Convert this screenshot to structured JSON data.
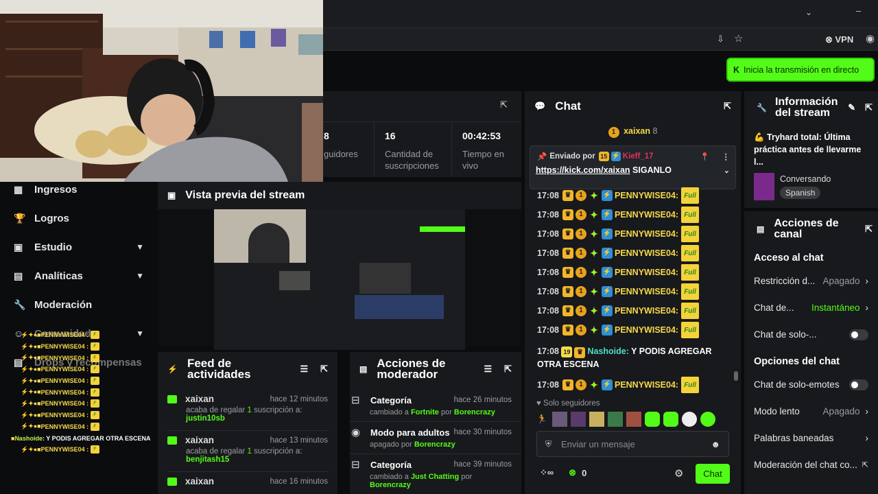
{
  "browser": {
    "vpn_label": "VPN"
  },
  "header": {
    "start_stream_label": "Inicia la transmisión en directo"
  },
  "stats": [
    {
      "value": "8",
      "label": "guidores"
    },
    {
      "value": "16",
      "label": "Cantidad de suscripciones"
    },
    {
      "value": "00:42:53",
      "label": "Tiempo en vivo"
    }
  ],
  "sidebar": {
    "items": [
      {
        "label": "Ingresos"
      },
      {
        "label": "Logros"
      },
      {
        "label": "Estudio"
      },
      {
        "label": "Analíticas"
      },
      {
        "label": "Moderación"
      },
      {
        "label": "Comunidad"
      },
      {
        "label": "Drops y recompensas"
      }
    ]
  },
  "preview": {
    "title": "Vista previa del stream"
  },
  "feed": {
    "title": "Feed de actividades",
    "items": [
      {
        "user": "xaixan",
        "time": "hace 12 minutos",
        "text": "acaba de regalar",
        "count": "1",
        "text2": "suscripción a:",
        "target": "justin10sb"
      },
      {
        "user": "xaixan",
        "time": "hace 13 minutos",
        "text": "acaba de regalar",
        "count": "1",
        "text2": "suscripción a:",
        "target": "benjitash15"
      },
      {
        "user": "xaixan",
        "time": "hace 16 minutos"
      }
    ]
  },
  "mod_actions": {
    "title": "Acciones de moderador",
    "items": [
      {
        "title": "Categoría",
        "time": "hace 26 minutos",
        "pre": "cambiado a",
        "value": "Fortnite",
        "by": "por",
        "mod": "Borencrazy"
      },
      {
        "title": "Modo para adultos",
        "time": "hace 30 minutos",
        "pre": "apagado por",
        "value": "",
        "by": "",
        "mod": "Borencrazy"
      },
      {
        "title": "Categoría",
        "time": "hace 39 minutos",
        "pre": "cambiado a",
        "value": "Just Chatting",
        "by": "por",
        "mod": "Borencrazy"
      }
    ]
  },
  "chat": {
    "title": "Chat",
    "top_user": "xaixan",
    "top_count": "8",
    "pinned_by_label": "Enviado por",
    "pinned_badge": "15",
    "pinned_user": "Kieff_17",
    "pinned_link": "https://kick.com/xaixan",
    "pinned_text": "SIGANLO",
    "repeat_user": "PENNYWISE04:",
    "emote_text": "Full",
    "time": "17:08",
    "nashoide_badge": "19",
    "nashoide_user": "Nashoide:",
    "nashoide_msg": "Y PODIS AGREGAR OTRA ESCENA",
    "followers_only": "Solo seguidores",
    "input_placeholder": "Enviar un mensaje",
    "points": "0",
    "send_label": "Chat"
  },
  "stream_info": {
    "title": "Información del stream",
    "stream_title": "💪 Tryhard total: Última práctica antes de llevarme l...",
    "category": "Conversando",
    "language": "Spanish"
  },
  "channel_actions": {
    "title": "Acciones de canal",
    "chat_access": "Acceso al chat",
    "rows1": [
      {
        "label": "Restricción d...",
        "value": "Apagado"
      },
      {
        "label": "Chat de...",
        "value": "Instantáneo"
      },
      {
        "label": "Chat de solo-...",
        "value": ""
      }
    ],
    "chat_options": "Opciones del chat",
    "rows2": [
      {
        "label": "Chat de solo-emotes",
        "value": ""
      },
      {
        "label": "Modo lento",
        "value": "Apagado"
      },
      {
        "label": "Palabras baneadas",
        "value": ""
      },
      {
        "label": "Moderación del chat co...",
        "value": ""
      }
    ]
  },
  "overlay": {
    "user": "PENNYWISE04 :",
    "nashoide": "Nashoide",
    "nashoide_msg": ": Y PODIS AGREGAR OTRA ESCENA"
  },
  "colors": {
    "accent": "#53fc18",
    "username_yellow": "#f6d84a",
    "panel": "#18191c"
  }
}
